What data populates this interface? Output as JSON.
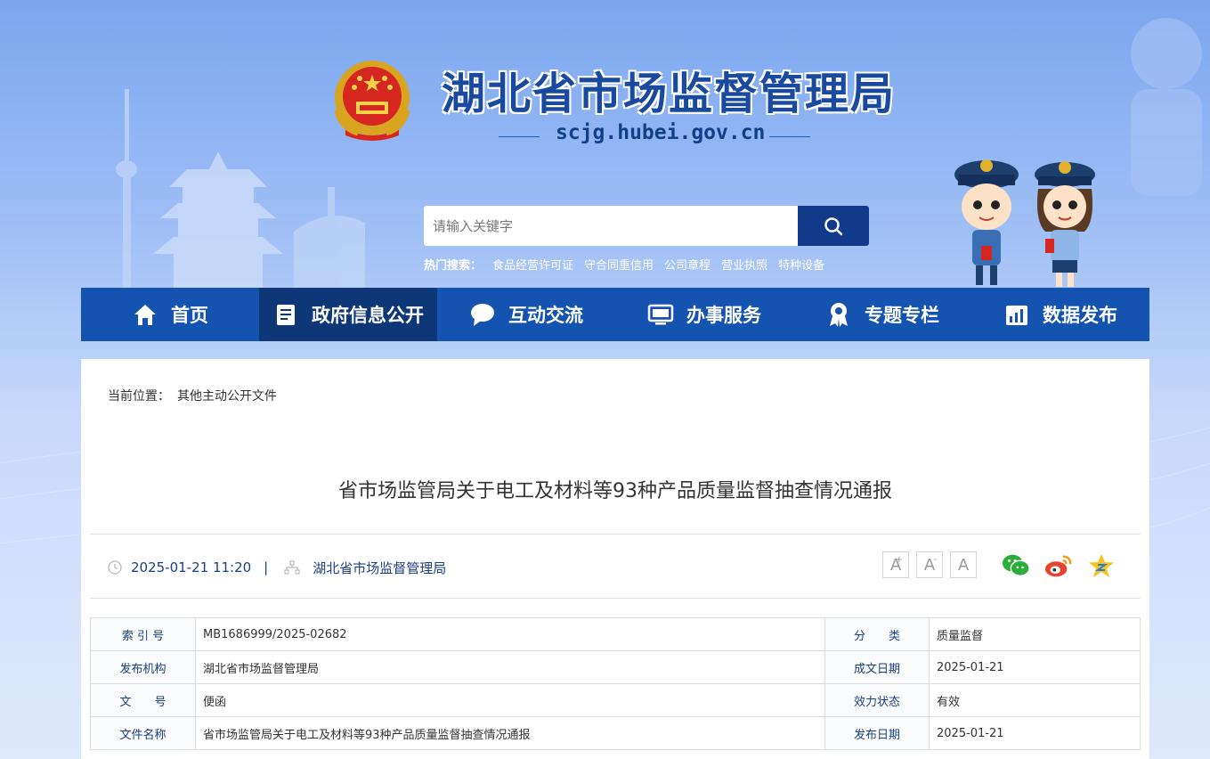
{
  "site": {
    "title": "湖北省市场监督管理局",
    "domain": "scjg.hubei.gov.cn"
  },
  "search": {
    "placeholder": "请输入关键字",
    "hot_label": "热门搜索：",
    "hot_links": [
      "食品经营许可证",
      "守合同重信用",
      "公司章程",
      "营业执照",
      "特种设备"
    ]
  },
  "nav": {
    "items": [
      {
        "label": "首页",
        "icon": "home-icon"
      },
      {
        "label": "政府信息公开",
        "icon": "document-icon"
      },
      {
        "label": "互动交流",
        "icon": "chat-icon"
      },
      {
        "label": "办事服务",
        "icon": "monitor-icon"
      },
      {
        "label": "专题专栏",
        "icon": "award-icon"
      },
      {
        "label": "数据发布",
        "icon": "chart-icon"
      }
    ],
    "active_index": 1
  },
  "breadcrumb": {
    "label": "当前位置：",
    "crumb": "其他主动公开文件"
  },
  "article": {
    "title": "省市场监管局关于电工及材料等93种产品质量监督抽查情况通报",
    "datetime": "2025-01-21 11:20",
    "separator": "|",
    "source": "湖北省市场监督管理局"
  },
  "font_size_buttons": [
    "A+",
    "A-",
    "A"
  ],
  "share_icons": [
    "wechat-icon",
    "weibo-icon",
    "qzone-icon"
  ],
  "info_table": {
    "rows": [
      {
        "label1": "索 引 号",
        "value1": "MB1686999/2025-02682",
        "label2": "分　　类",
        "value2": "质量监督"
      },
      {
        "label1": "发布机构",
        "value1": "湖北省市场监督管理局",
        "label2": "成文日期",
        "value2": "2025-01-21"
      },
      {
        "label1": "文　　号",
        "value1": "便函",
        "label2": "效力状态",
        "value2": "有效"
      },
      {
        "label1": "文件名称",
        "value1": "省市场监管局关于电工及材料等93种产品质量监督抽查情况通报",
        "label2": "发布日期",
        "value2": "2025-01-21"
      }
    ]
  },
  "colors": {
    "nav_bg": "#1553b0",
    "nav_active": "#0e3778",
    "search_btn": "#113a8a",
    "label_text": "#1a3f80"
  }
}
